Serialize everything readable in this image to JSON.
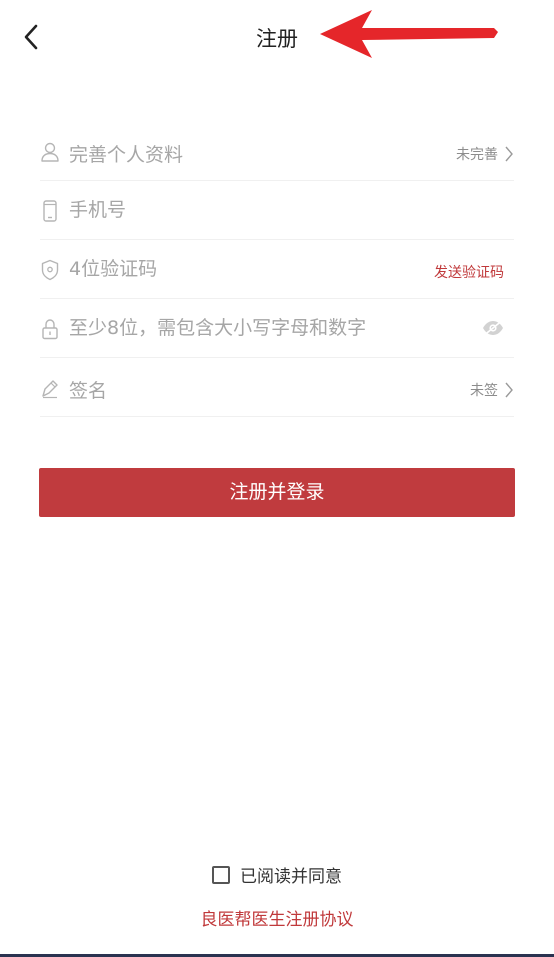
{
  "header": {
    "title": "注册",
    "back_icon": "chevron-left-icon",
    "annotation_arrow_color": "#e5262a"
  },
  "form": {
    "profile": {
      "icon": "user-icon",
      "label": "完善个人资料",
      "status": "未完善"
    },
    "phone": {
      "icon": "phone-icon",
      "placeholder": "手机号"
    },
    "code": {
      "icon": "shield-icon",
      "placeholder": "4位验证码",
      "send_label": "发送验证码"
    },
    "password": {
      "icon": "lock-icon",
      "placeholder": "至少8位，需包含大小写字母和数字",
      "toggle_icon": "eye-icon"
    },
    "signature": {
      "icon": "pen-icon",
      "label": "签名",
      "status": "未签"
    }
  },
  "submit_label": "注册并登录",
  "footer": {
    "agree_text": "已阅读并同意",
    "protocol_link": "良医帮医生注册协议"
  },
  "colors": {
    "accent": "#c03b3e",
    "placeholder": "#a6a6a6",
    "divider": "#f0f0f0"
  }
}
